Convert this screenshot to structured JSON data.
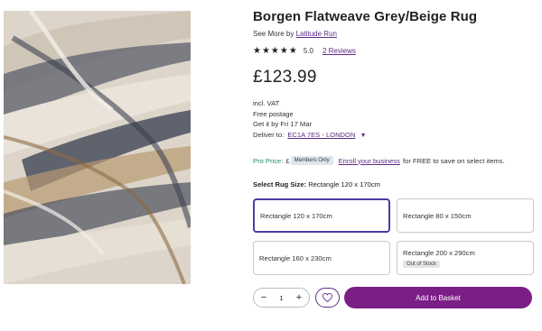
{
  "product": {
    "title": "Borgen Flatweave Grey/Beige Rug",
    "see_more_prefix": "See More by",
    "brand": "Latitude Run",
    "stars": "★★★★★",
    "rating": "5.0",
    "reviews": "2 Reviews",
    "price": "£123.99",
    "vat": "incl. VAT",
    "postage": "Free postage",
    "delivery_date": "Get it by Fri 17 Mar",
    "deliver_label": "Deliver to:",
    "postcode": "EC1A 7ES - LONDON"
  },
  "pro": {
    "label": "Pro Price:",
    "pound": "£",
    "badge": "Members Only",
    "enroll": "Enroll your business",
    "suffix": "for FREE to save on select items."
  },
  "size": {
    "heading": "Select Rug Size:",
    "selected": "Rectangle 120 x 170cm",
    "options": [
      {
        "label": "Rectangle 120 x 170cm",
        "state": "selected"
      },
      {
        "label": "Rectangle 80 x 150cm",
        "state": ""
      },
      {
        "label": "Rectangle 160 x 230cm",
        "state": ""
      },
      {
        "label": "Rectangle 200 x 290cm",
        "state": "Out of Stock"
      }
    ]
  },
  "purchase": {
    "minus": "−",
    "quantity": "1",
    "plus": "+",
    "add_to_basket": "Add to Basket"
  },
  "colors": {
    "accent": "#7b1f86",
    "link": "#5f2b84",
    "selected_border": "#4d3aa6",
    "pro_green": "#1f8a70"
  },
  "icons": {
    "stars": "star-icon",
    "chevron": "chevron-down-icon",
    "wishlist": "heart-icon"
  }
}
